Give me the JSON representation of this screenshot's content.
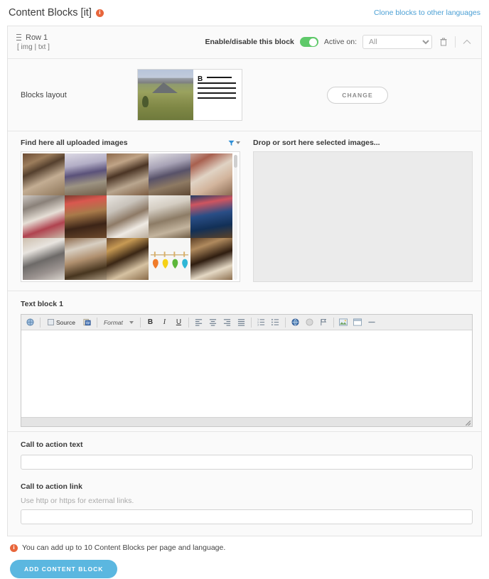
{
  "header": {
    "title": "Content Blocks [it]",
    "info_icon": "info-icon",
    "clone_link": "Clone blocks to other languages"
  },
  "block": {
    "row_title": "Row 1",
    "row_subtitle": "[ img | txt ]",
    "enable_label": "Enable/disable this block",
    "toggle_state": "on",
    "active_on_label": "Active on:",
    "active_on_value": "All",
    "active_on_options": [
      "All"
    ],
    "delete_icon": "trash-icon",
    "collapse_icon": "chevron-up-icon",
    "drag_icon": "drag-handle-icon"
  },
  "layout": {
    "label": "Blocks layout",
    "thumb_alt": "image-left-text-right-layout",
    "thumb_bold_letter": "B",
    "change_button": "CHANGE"
  },
  "images": {
    "left_title": "Find here all uploaded images",
    "filter_icon": "filter-funnel-icon",
    "filter_caret": "chevron-down-icon",
    "right_title": "Drop or sort here selected images...",
    "thumbnails": [
      "hotel-room-wooden-doors",
      "bedroom-purple-headboard",
      "bedroom-artwork-wall",
      "lounge-blue-partition",
      "bedroom-red-patterned-wall",
      "room-grey-headboard-tv",
      "bar-counter-bartender",
      "attic-room-beams-bed",
      "corridor-wall-tv",
      "bar-counter-blue-lit",
      "bedroom-grey-cushions",
      "lounge-sofa-coffee-table",
      "corridor-elevator-doors",
      "colorful-hanging-hearts",
      "suite-bed-warm-light"
    ],
    "thumbnail_count": 15,
    "scrollbar": "vertical-scrollbar"
  },
  "text_block": {
    "label": "Text block 1",
    "content": "",
    "toolbar": {
      "maximize": "maximize-icon",
      "source_label": "Source",
      "paste_word": "paste-from-word-icon",
      "format_label": "Format",
      "bold": "B",
      "italic": "I",
      "underline": "U",
      "align_left": "align-left-icon",
      "align_center": "align-center-icon",
      "align_right": "align-right-icon",
      "align_justify": "align-justify-icon",
      "numbered_list": "numbered-list-icon",
      "bulleted_list": "bulleted-list-icon",
      "link": "link-icon",
      "unlink": "unlink-icon",
      "anchor": "anchor-flag-icon",
      "image": "image-icon",
      "iframe": "iframe-icon",
      "horizontal_rule": "horizontal-rule-icon"
    }
  },
  "cta": {
    "text_label": "Call to action text",
    "text_value": "",
    "link_label": "Call to action link",
    "link_hint": "Use http or https for external links.",
    "link_value": ""
  },
  "footer": {
    "note": "You can add up to 10 Content Blocks per page and language.",
    "note_icon": "info-icon",
    "add_button": "ADD CONTENT BLOCK"
  },
  "colors": {
    "accent_blue": "#5bb7e0",
    "link_blue": "#4a9fd4",
    "toggle_green": "#5fc96a",
    "info_orange": "#e8663c",
    "filter_blue": "#2f8fd6"
  }
}
